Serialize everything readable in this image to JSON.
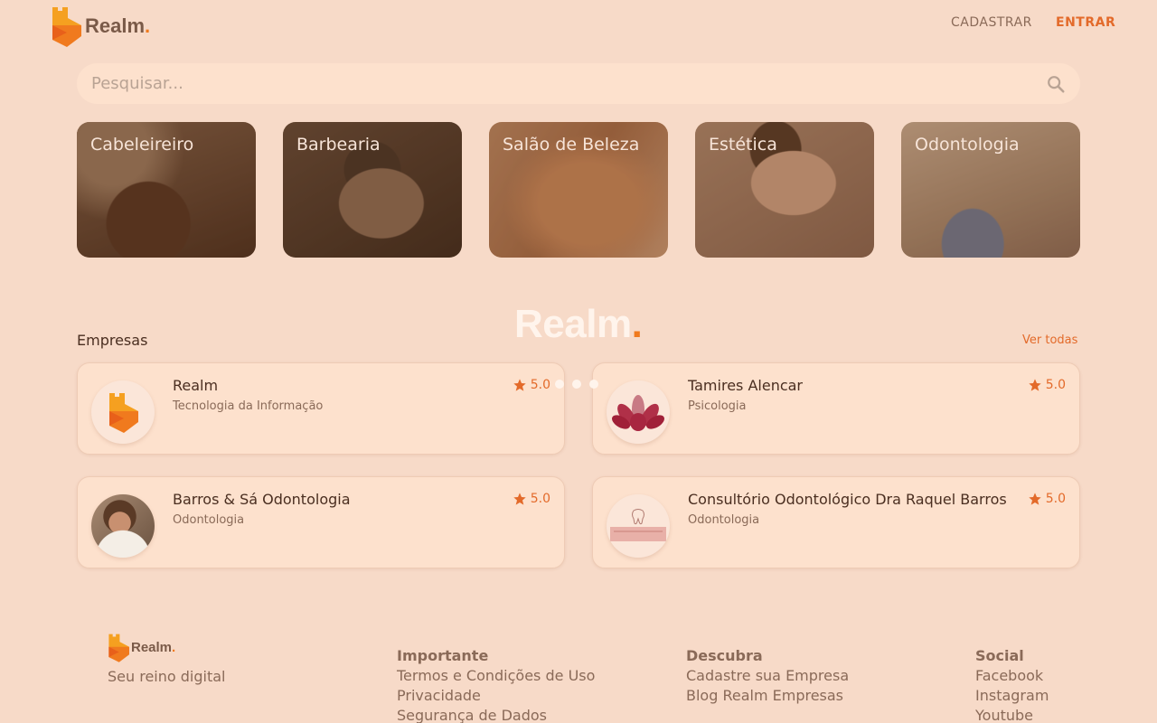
{
  "header": {
    "logo_text": "Realm",
    "logo_dot": ".",
    "nav": {
      "signup": "CADASTRAR",
      "login": "ENTRAR"
    }
  },
  "search": {
    "placeholder": "Pesquisar...",
    "value": ""
  },
  "categories": [
    {
      "label": "Cabeleireiro"
    },
    {
      "label": "Barbearia"
    },
    {
      "label": "Salão de Beleza"
    },
    {
      "label": "Estética"
    },
    {
      "label": "Odontologia"
    }
  ],
  "loader": {
    "title": "Realm",
    "dot": "."
  },
  "companies_section": {
    "title": "Empresas",
    "see_all": "Ver todas"
  },
  "companies": [
    {
      "name": "Realm",
      "category": "Tecnologia da Informação",
      "rating": "5.0"
    },
    {
      "name": "Tamires Alencar",
      "category": "Psicologia",
      "rating": "5.0"
    },
    {
      "name": "Barros & Sá Odontologia",
      "category": "Odontologia",
      "rating": "5.0"
    },
    {
      "name": "Consultório Odontológico Dra Raquel Barros",
      "category": "Odontologia",
      "rating": "5.0"
    }
  ],
  "footer": {
    "logo_text": "Realm",
    "logo_dot": ".",
    "tagline": "Seu reino digital",
    "columns": [
      {
        "title": "Importante",
        "links": [
          "Termos e Condições de Uso",
          "Privacidade",
          "Segurança de Dados"
        ]
      },
      {
        "title": "Descubra",
        "links": [
          "Cadastre sua Empresa",
          "Blog Realm Empresas"
        ]
      },
      {
        "title": "Social",
        "links": [
          "Facebook",
          "Instagram",
          "Youtube"
        ]
      }
    ]
  },
  "colors": {
    "accent": "#e36a2a",
    "brand_orange": "#f07a1e",
    "background": "#f7dac8",
    "card": "#fde1cd"
  }
}
